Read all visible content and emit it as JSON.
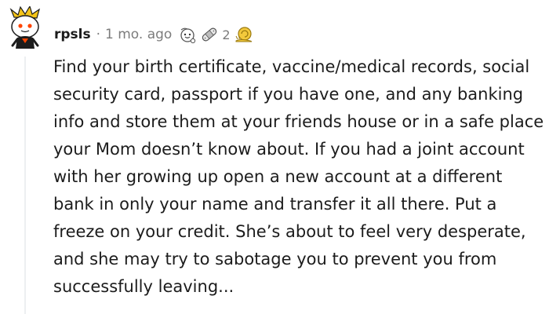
{
  "comment": {
    "username": "rpsls",
    "separator": "·",
    "time": "1 mo. ago",
    "awards": [
      {
        "icon": "wholesome-seal-award-icon"
      },
      {
        "icon": "bandaid-award-icon",
        "count": "2"
      },
      {
        "icon": "golden-snail-award-icon"
      }
    ],
    "body": "Find your birth certificate, vaccine/medical records, social security card, passport if you have one, and any banking info and store them at your friends house or in a safe place your Mom doesn’t know about. If you had a joint account with her growing up open a new account at a different bank in only your name and transfer it all there. Put a freeze on your credit. She’s about to feel very desperate, and she may try to sabotage you to prevent you from successfully leaving..."
  },
  "colors": {
    "avatar_face": "#ffffff",
    "avatar_hair": "#f5c518",
    "avatar_shirt": "#ff4500",
    "meta_gray": "#7c7c7c",
    "text": "#1c1c1c"
  }
}
